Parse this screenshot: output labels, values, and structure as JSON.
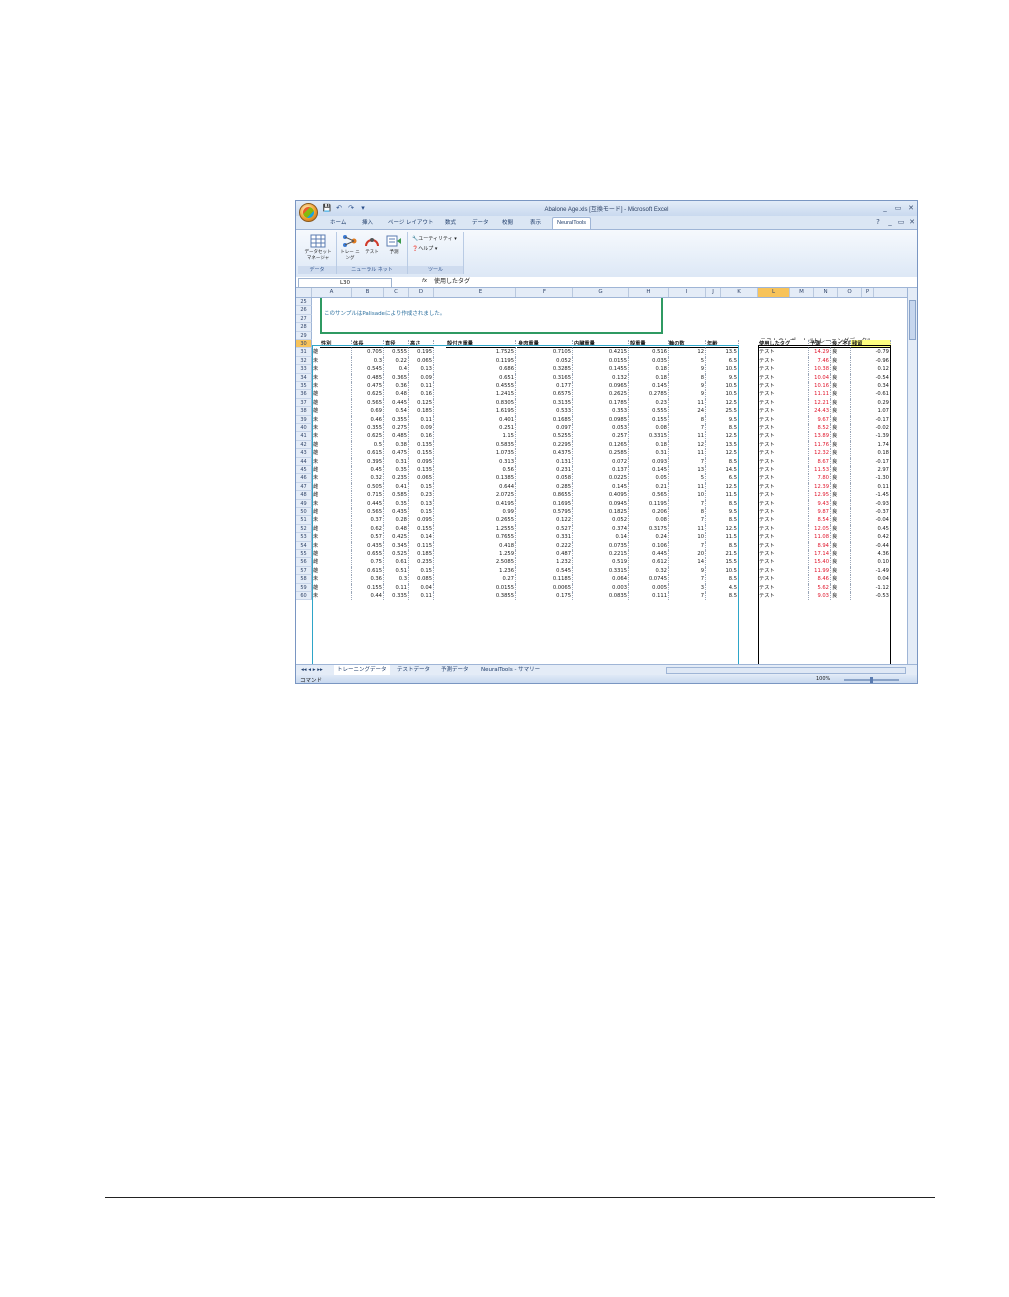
{
  "window": {
    "title": "Abalone Age.xls [互換モード] - Microsoft Excel",
    "qat": [
      "💾",
      "↶",
      "↷",
      "▾"
    ],
    "controls": [
      "_",
      "▭",
      "✕"
    ],
    "ribbon_controls": [
      "?",
      "_",
      "▭",
      "✕"
    ]
  },
  "ribbon": {
    "tabs": [
      "ホーム",
      "挿入",
      "ページ レイアウト",
      "数式",
      "データ",
      "校閲",
      "表示",
      "NeuralTools"
    ],
    "active_tab": "NeuralTools",
    "groups": {
      "data": {
        "label": "データ",
        "buttons": [
          "データセット マネージャ"
        ]
      },
      "neural_net": {
        "label": "ニューラル ネット",
        "buttons": [
          "トレー ニング",
          "テスト",
          "予測"
        ]
      },
      "tools": {
        "label": "ツール",
        "commands": [
          "ユーティリティ ▾",
          "ヘルプ ▾"
        ]
      }
    }
  },
  "formula_bar": {
    "name_box": "L30",
    "fx": "fx",
    "content": "使用したタグ"
  },
  "columns": [
    "A",
    "B",
    "C",
    "D",
    "E",
    "F",
    "G",
    "H",
    "I",
    "J",
    "K",
    "L",
    "M",
    "N",
    "O",
    "P"
  ],
  "selected_column": "L",
  "note": "このサンプルはPalisadeにより作成されました。",
  "right_title": "テストのレポート:”トレーニングデータ”",
  "headers": [
    "性別",
    "体長",
    "直径",
    "高さ",
    "殻付き重量",
    "身肉重量",
    "内臓重量",
    "殻重量",
    "輪の数",
    "年齢"
  ],
  "right_headers": [
    "使用したタグ",
    "予測",
    "良／不良",
    "残留"
  ],
  "rows": [
    {
      "n": "31",
      "sex": "雄",
      "v": [
        "0.705",
        "0.555",
        "0.195",
        "1.7525",
        "0.7105",
        "0.4215",
        "0.516",
        "12",
        "13.5"
      ],
      "tag": "テスト",
      "pred": "14.29",
      "ok": "良",
      "res": "-0.79"
    },
    {
      "n": "32",
      "sex": "未",
      "v": [
        "0.3",
        "0.22",
        "0.065",
        "0.1195",
        "0.052",
        "0.0155",
        "0.035",
        "5",
        "6.5"
      ],
      "tag": "テスト",
      "pred": "7.46",
      "ok": "良",
      "res": "-0.96"
    },
    {
      "n": "33",
      "sex": "未",
      "v": [
        "0.545",
        "0.4",
        "0.13",
        "0.686",
        "0.3285",
        "0.1455",
        "0.18",
        "9",
        "10.5"
      ],
      "tag": "テスト",
      "pred": "10.38",
      "ok": "良",
      "res": "0.12"
    },
    {
      "n": "34",
      "sex": "未",
      "v": [
        "0.485",
        "0.365",
        "0.09",
        "0.651",
        "0.3165",
        "0.132",
        "0.18",
        "8",
        "9.5"
      ],
      "tag": "テスト",
      "pred": "10.04",
      "ok": "良",
      "res": "-0.54"
    },
    {
      "n": "35",
      "sex": "未",
      "v": [
        "0.475",
        "0.36",
        "0.11",
        "0.4555",
        "0.177",
        "0.0965",
        "0.145",
        "9",
        "10.5"
      ],
      "tag": "テスト",
      "pred": "10.16",
      "ok": "良",
      "res": "0.34"
    },
    {
      "n": "36",
      "sex": "雄",
      "v": [
        "0.625",
        "0.48",
        "0.16",
        "1.2415",
        "0.6575",
        "0.2625",
        "0.2785",
        "9",
        "10.5"
      ],
      "tag": "テスト",
      "pred": "11.11",
      "ok": "良",
      "res": "-0.61"
    },
    {
      "n": "37",
      "sex": "雄",
      "v": [
        "0.565",
        "0.445",
        "0.125",
        "0.8305",
        "0.3135",
        "0.1785",
        "0.23",
        "11",
        "12.5"
      ],
      "tag": "テスト",
      "pred": "12.21",
      "ok": "良",
      "res": "0.29"
    },
    {
      "n": "38",
      "sex": "雄",
      "v": [
        "0.69",
        "0.54",
        "0.185",
        "1.6195",
        "0.533",
        "0.353",
        "0.555",
        "24",
        "25.5"
      ],
      "tag": "テスト",
      "pred": "24.43",
      "ok": "良",
      "res": "1.07"
    },
    {
      "n": "39",
      "sex": "未",
      "v": [
        "0.46",
        "0.355",
        "0.11",
        "0.401",
        "0.1685",
        "0.0985",
        "0.155",
        "8",
        "9.5"
      ],
      "tag": "テスト",
      "pred": "9.67",
      "ok": "良",
      "res": "-0.17"
    },
    {
      "n": "40",
      "sex": "未",
      "v": [
        "0.355",
        "0.275",
        "0.09",
        "0.251",
        "0.097",
        "0.053",
        "0.08",
        "7",
        "8.5"
      ],
      "tag": "テスト",
      "pred": "8.52",
      "ok": "良",
      "res": "-0.02"
    },
    {
      "n": "41",
      "sex": "未",
      "v": [
        "0.625",
        "0.485",
        "0.16",
        "1.15",
        "0.5255",
        "0.257",
        "0.3315",
        "11",
        "12.5"
      ],
      "tag": "テスト",
      "pred": "13.89",
      "ok": "良",
      "res": "-1.39"
    },
    {
      "n": "42",
      "sex": "雄",
      "v": [
        "0.5",
        "0.38",
        "0.135",
        "0.5835",
        "0.2295",
        "0.1265",
        "0.18",
        "12",
        "13.5"
      ],
      "tag": "テスト",
      "pred": "11.76",
      "ok": "良",
      "res": "1.74"
    },
    {
      "n": "43",
      "sex": "雄",
      "v": [
        "0.615",
        "0.475",
        "0.155",
        "1.0735",
        "0.4375",
        "0.2585",
        "0.31",
        "11",
        "12.5"
      ],
      "tag": "テスト",
      "pred": "12.32",
      "ok": "良",
      "res": "0.18"
    },
    {
      "n": "44",
      "sex": "未",
      "v": [
        "0.395",
        "0.31",
        "0.095",
        "0.313",
        "0.131",
        "0.072",
        "0.093",
        "7",
        "8.5"
      ],
      "tag": "テスト",
      "pred": "8.67",
      "ok": "良",
      "res": "-0.17"
    },
    {
      "n": "45",
      "sex": "雌",
      "v": [
        "0.45",
        "0.35",
        "0.135",
        "0.56",
        "0.231",
        "0.137",
        "0.145",
        "13",
        "14.5"
      ],
      "tag": "テスト",
      "pred": "11.53",
      "ok": "良",
      "res": "2.97"
    },
    {
      "n": "46",
      "sex": "未",
      "v": [
        "0.32",
        "0.235",
        "0.065",
        "0.1385",
        "0.058",
        "0.0225",
        "0.05",
        "5",
        "6.5"
      ],
      "tag": "テスト",
      "pred": "7.80",
      "ok": "良",
      "res": "-1.30"
    },
    {
      "n": "47",
      "sex": "雌",
      "v": [
        "0.505",
        "0.41",
        "0.15",
        "0.644",
        "0.285",
        "0.145",
        "0.21",
        "11",
        "12.5"
      ],
      "tag": "テスト",
      "pred": "12.39",
      "ok": "良",
      "res": "0.11"
    },
    {
      "n": "48",
      "sex": "雌",
      "v": [
        "0.715",
        "0.585",
        "0.23",
        "2.0725",
        "0.8655",
        "0.4095",
        "0.565",
        "10",
        "11.5"
      ],
      "tag": "テスト",
      "pred": "12.95",
      "ok": "良",
      "res": "-1.45"
    },
    {
      "n": "49",
      "sex": "未",
      "v": [
        "0.445",
        "0.35",
        "0.13",
        "0.4195",
        "0.1695",
        "0.0945",
        "0.1195",
        "7",
        "8.5"
      ],
      "tag": "テスト",
      "pred": "9.43",
      "ok": "良",
      "res": "-0.93"
    },
    {
      "n": "50",
      "sex": "雌",
      "v": [
        "0.565",
        "0.435",
        "0.15",
        "0.99",
        "0.5795",
        "0.1825",
        "0.206",
        "8",
        "9.5"
      ],
      "tag": "テスト",
      "pred": "9.87",
      "ok": "良",
      "res": "-0.37"
    },
    {
      "n": "51",
      "sex": "未",
      "v": [
        "0.37",
        "0.28",
        "0.095",
        "0.2655",
        "0.122",
        "0.052",
        "0.08",
        "7",
        "8.5"
      ],
      "tag": "テスト",
      "pred": "8.54",
      "ok": "良",
      "res": "-0.04"
    },
    {
      "n": "52",
      "sex": "雌",
      "v": [
        "0.62",
        "0.48",
        "0.155",
        "1.2555",
        "0.527",
        "0.374",
        "0.3175",
        "11",
        "12.5"
      ],
      "tag": "テスト",
      "pred": "12.05",
      "ok": "良",
      "res": "0.45"
    },
    {
      "n": "53",
      "sex": "未",
      "v": [
        "0.57",
        "0.425",
        "0.14",
        "0.7655",
        "0.331",
        "0.14",
        "0.24",
        "10",
        "11.5"
      ],
      "tag": "テスト",
      "pred": "11.08",
      "ok": "良",
      "res": "0.42"
    },
    {
      "n": "54",
      "sex": "未",
      "v": [
        "0.435",
        "0.345",
        "0.115",
        "0.418",
        "0.222",
        "0.0735",
        "0.106",
        "7",
        "8.5"
      ],
      "tag": "テスト",
      "pred": "8.94",
      "ok": "良",
      "res": "-0.44"
    },
    {
      "n": "55",
      "sex": "雄",
      "v": [
        "0.655",
        "0.525",
        "0.185",
        "1.259",
        "0.487",
        "0.2215",
        "0.445",
        "20",
        "21.5"
      ],
      "tag": "テスト",
      "pred": "17.14",
      "ok": "良",
      "res": "4.36"
    },
    {
      "n": "56",
      "sex": "雌",
      "v": [
        "0.75",
        "0.61",
        "0.235",
        "2.5085",
        "1.232",
        "0.519",
        "0.612",
        "14",
        "15.5"
      ],
      "tag": "テスト",
      "pred": "15.40",
      "ok": "良",
      "res": "0.10"
    },
    {
      "n": "57",
      "sex": "雄",
      "v": [
        "0.615",
        "0.51",
        "0.15",
        "1.236",
        "0.545",
        "0.3315",
        "0.32",
        "9",
        "10.5"
      ],
      "tag": "テスト",
      "pred": "11.99",
      "ok": "良",
      "res": "-1.49"
    },
    {
      "n": "58",
      "sex": "未",
      "v": [
        "0.36",
        "0.3",
        "0.085",
        "0.27",
        "0.1185",
        "0.064",
        "0.0745",
        "7",
        "8.5"
      ],
      "tag": "テスト",
      "pred": "8.46",
      "ok": "良",
      "res": "0.04"
    },
    {
      "n": "59",
      "sex": "雄",
      "v": [
        "0.155",
        "0.11",
        "0.04",
        "0.0155",
        "0.0065",
        "0.003",
        "0.005",
        "3",
        "4.5"
      ],
      "tag": "テスト",
      "pred": "5.62",
      "ok": "良",
      "res": "-1.12"
    },
    {
      "n": "60",
      "sex": "未",
      "v": [
        "0.44",
        "0.335",
        "0.11",
        "0.3855",
        "0.175",
        "0.0835",
        "0.111",
        "7",
        "8.5"
      ],
      "tag": "テスト",
      "pred": "9.03",
      "ok": "良",
      "res": "-0.53"
    }
  ],
  "sheet_tabs": [
    "トレーニングデータ",
    "テストデータ",
    "予測データ",
    "NeuralTools - サマリー"
  ],
  "sheet_nav": "◂◂ ◂ ▸ ▸▸",
  "status": {
    "mode": "コマンド",
    "zoom": "100%"
  }
}
